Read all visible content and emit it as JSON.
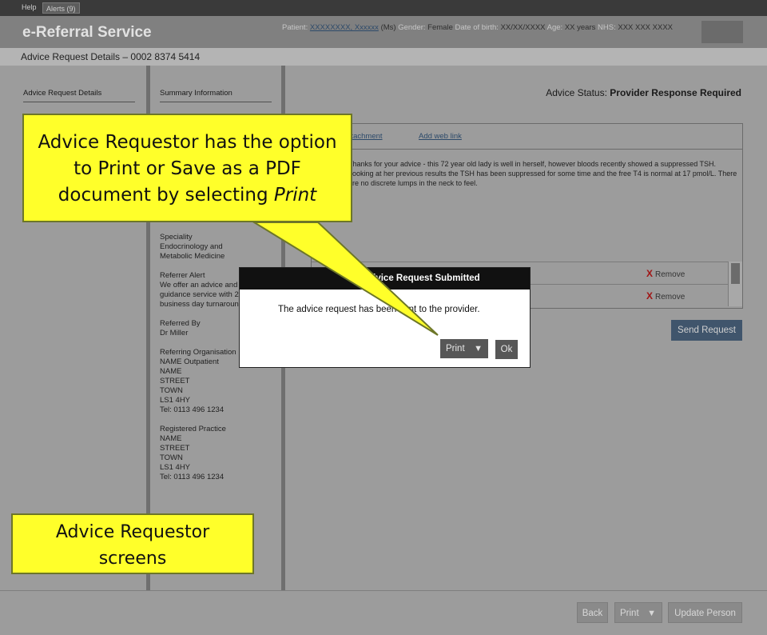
{
  "topbar": {
    "help": "Help",
    "alerts": "Alerts (9)"
  },
  "header": {
    "brand": "e-Referral Service",
    "patient_label": "Patient:",
    "patient_name": "XXXXXXXX, Xxxxxx",
    "patient_title": "(Ms)",
    "gender_label": "Gender:",
    "gender": "Female",
    "dob_label": "Date of birth:",
    "dob": "XX/XX/XXXX",
    "age_label": "Age:",
    "age": "XX years",
    "nhs_label": "NHS:",
    "nhs": "XXX XXX XXXX"
  },
  "page": {
    "title": "Advice Request Details – 0002 8374 5414"
  },
  "left_nav": {
    "item": "Advice Request Details"
  },
  "summary": {
    "title": "Summary Information",
    "specialty": [
      "Speciality",
      "Endocrinology and",
      "Metabolic Medicine"
    ],
    "referrer_alert": [
      "Referrer Alert",
      "We offer an advice and",
      "guidance service with 2",
      "business day turnaround"
    ],
    "referred_by": [
      "Referred By",
      "Dr Miller"
    ],
    "referring_org": [
      "Referring Organisation",
      "NAME Outpatient",
      "NAME",
      "STREET",
      "TOWN",
      "LS1 4HY",
      "Tel: 0113 496 1234"
    ],
    "registered_practice": [
      "Registered Practice",
      "NAME",
      "STREET",
      "TOWN",
      "LS1 4HY",
      "Tel: 0113 496 1234"
    ]
  },
  "main": {
    "status_label": "Advice Status:",
    "status_value": "Provider Response Required",
    "add_attachment": "Add attachment",
    "add_web_link": "Add web link",
    "message": "Thanks for your advice - this 72 year old lady is well in herself, however bloods recently showed a suppressed TSH. Looking at her previous results the TSH has been suppressed for some time and the free T4 is normal at 17 pmol/L. There are no discrete lumps in the neck to feel.",
    "remove_label": "Remove",
    "send_button": "Send Request"
  },
  "dialog": {
    "title": "Advice Request Submitted",
    "message": "The advice request has been sent to the provider.",
    "print": "Print",
    "ok": "Ok"
  },
  "footer": {
    "back": "Back",
    "print": "Print",
    "update": "Update Person"
  },
  "callouts": {
    "print_line1": "Advice Requestor has the option",
    "print_line2": "to Print or Save as a PDF",
    "print_line3_a": "document by selecting ",
    "print_line3_b": "Print",
    "screens_line1": "Advice Requestor",
    "screens_line2": "screens"
  },
  "icons": {
    "dropdown": "triangle-down-icon",
    "remove": "x-icon"
  },
  "colors": {
    "callout": "#ffff2a",
    "send_button": "#40556c",
    "remove_x": "#a01515",
    "dialog_header": "#111111"
  }
}
